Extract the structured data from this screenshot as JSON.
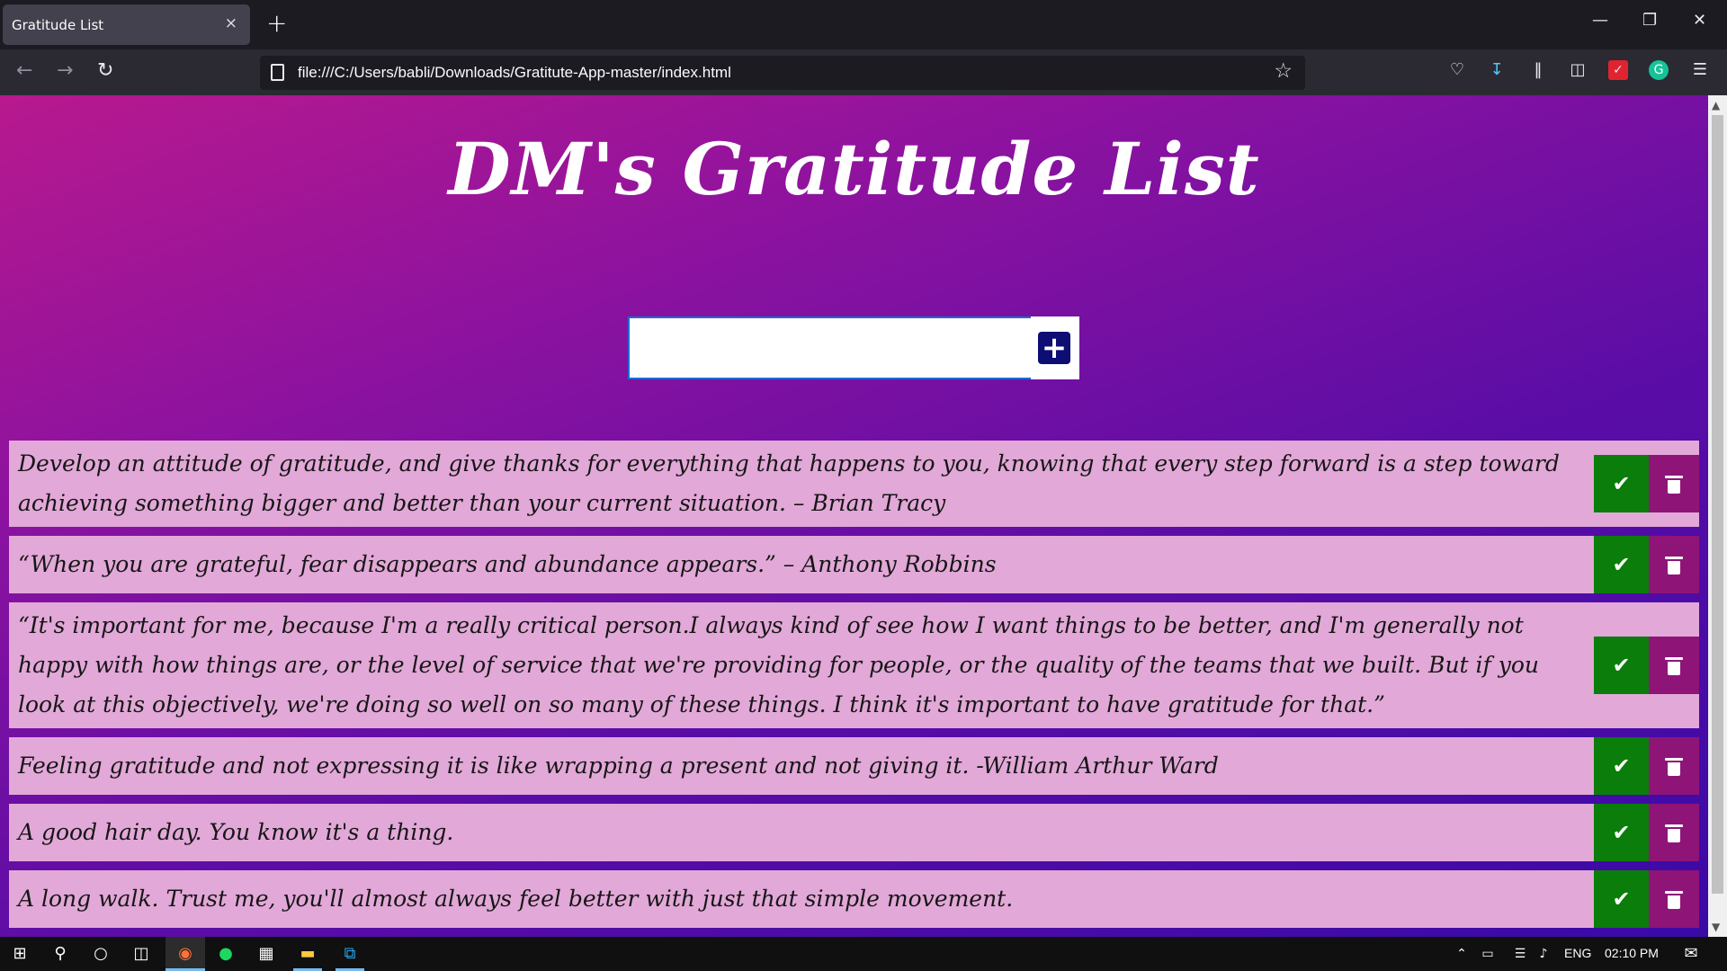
{
  "browser": {
    "tab_title": "Gratitude List",
    "tab_close": "×",
    "new_tab": "+",
    "url": "file:///C:/Users/babli/Downloads/Gratitute-App-master/index.html",
    "window_controls": {
      "minimize": "—",
      "restore": "❐",
      "close": "✕"
    }
  },
  "page": {
    "title": "DM's Gratitude List",
    "input_value": "",
    "add_icon": "+"
  },
  "todos": [
    {
      "text": "Develop an attitude of gratitude, and give thanks for everything that happens to you, knowing that every step forward is a step toward achieving something bigger and better than your current situation. – Brian Tracy"
    },
    {
      "text": "“When you are grateful, fear disappears and abundance appears.” – Anthony Robbins"
    },
    {
      "text": "“It's important for me, because I'm a really critical person.I always kind of see how I want things to be better, and I'm generally not happy with how things are, or the level of service that we're providing for people, or the quality of the teams that we built. But if you look at this objectively, we're doing so well on so many of these things. I think it's important to have gratitude for that.”"
    },
    {
      "text": "Feeling gratitude and not expressing it is like wrapping a present and not giving it. -William Arthur Ward"
    },
    {
      "text": "A good hair day. You know it's a thing."
    },
    {
      "text": "A long walk. Trust me, you'll almost always feel better with just that simple movement."
    },
    {
      "text": ""
    }
  ],
  "taskbar": {
    "language": "ENG",
    "time": "02:10 PM"
  },
  "colors": {
    "check_button": "#0a7d0a",
    "trash_button": "#8f1478",
    "todo_background": "#e2a8d8",
    "add_button": "#0d0d73"
  }
}
